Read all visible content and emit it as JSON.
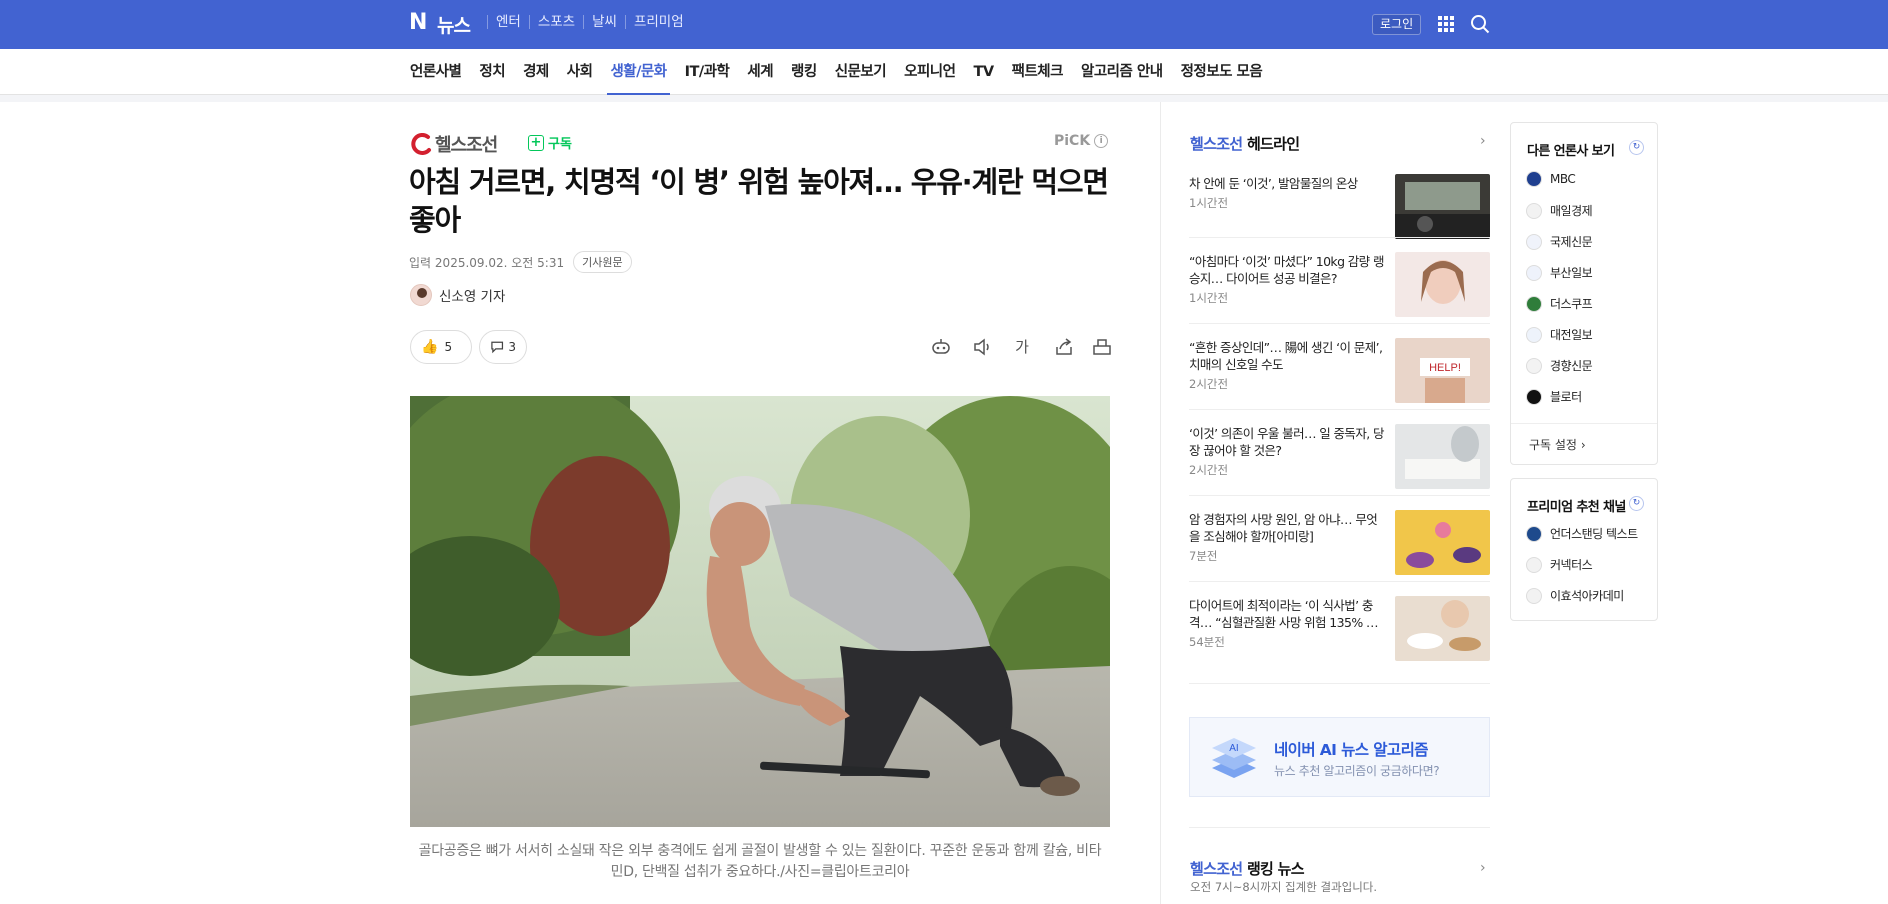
{
  "header": {
    "logo_letter": "N",
    "logo_text": "뉴스",
    "top_nav": [
      "엔터",
      "스포츠",
      "날씨",
      "프리미엄"
    ],
    "login_label": "로그인"
  },
  "category_nav": {
    "items": [
      "언론사별",
      "정치",
      "경제",
      "사회",
      "생활/문화",
      "IT/과학",
      "세계",
      "랭킹",
      "신문보기",
      "오피니언",
      "TV",
      "팩트체크",
      "알고리즘 안내",
      "정정보도 모음"
    ],
    "active": "생활/문화"
  },
  "article": {
    "press_name": "헬스조선",
    "subscribe_label": "구독",
    "pick_label": "PiCK",
    "pick_info": "i",
    "headline": "아침 거르면, 치명적 ‘이 병’ 위험 높아져… 우유·계란 먹으면 좋아",
    "input_label": "입력",
    "date": "2025.09.02. 오전 5:31",
    "source_button": "기사원문",
    "reporter": "신소영 기자",
    "reaction_count": "5",
    "comment_count": "3",
    "font_size_label": "가",
    "caption": "골다공증은 뼈가 서서히 소실돼 작은 외부 충격에도 쉽게 골절이 발생할 수 있는 질환이다. 꾸준한 운동과 함께 칼슘, 비타민D, 단백질 섭취가 중요하다./사진=클립아트코리아"
  },
  "headline_list": {
    "press": "헬스조선",
    "title": "헤드라인",
    "items": [
      {
        "title": "차 안에 둔 ‘이것’, 발암물질의 온상",
        "time": "1시간전"
      },
      {
        "title": "“아침마다 ‘이것’ 마셨다” 10kg 감량 랭승지… 다이어트 성공 비결은?",
        "time": "1시간전"
      },
      {
        "title": "“흔한 증상인데”… 陽에 생긴 ‘이 문제’, 치매의 신호일 수도",
        "time": "2시간전"
      },
      {
        "title": "‘이것’ 의존이 우울 불러… 일 중독자, 당장 끊어야 할 것은?",
        "time": "2시간전"
      },
      {
        "title": "암 경험자의 사망 원인, 암 아냐… 무엇을 조심해야 할까[아미랑]",
        "time": "7분전"
      },
      {
        "title": "다이어트에 최적이라는 ‘이 식사법’ 충격… “심혈관질환 사망 위험 135% …",
        "time": "54분전"
      }
    ]
  },
  "ai_banner": {
    "icon_label": "AI",
    "title": "네이버 AI 뉴스 알고리즘",
    "subtitle": "뉴스 추천 알고리즘이 궁금하다면?"
  },
  "ranking": {
    "press": "헬스조선",
    "title": "랭킹 뉴스",
    "subtitle": "오전 7시~8시까지 집계한 결과입니다."
  },
  "other_press": {
    "title": "다른 언론사 보기",
    "items": [
      {
        "name": "MBC",
        "color": "#1f3f8f"
      },
      {
        "name": "매일경제",
        "color": "#f2f2f2"
      },
      {
        "name": "국제신문",
        "color": "#f0f3fb"
      },
      {
        "name": "부산일보",
        "color": "#eef2fb"
      },
      {
        "name": "더스쿠프",
        "color": "#2f7d3a"
      },
      {
        "name": "대전일보",
        "color": "#eef3fb"
      },
      {
        "name": "경향신문",
        "color": "#f3f3f3"
      },
      {
        "name": "블로터",
        "color": "#111111"
      }
    ],
    "subscribe_setting": "구독 설정"
  },
  "premium": {
    "title": "프리미엄 추천 채널",
    "items": [
      {
        "name": "언더스탠딩 텍스트",
        "color": "#1e4a8c"
      },
      {
        "name": "커넥터스",
        "color": "#f2f2f2"
      },
      {
        "name": "이효석아카데미",
        "color": "#f2f2f2"
      }
    ]
  },
  "colors": {
    "brand": "#4263d1",
    "subscribe_green": "#03c75a"
  }
}
